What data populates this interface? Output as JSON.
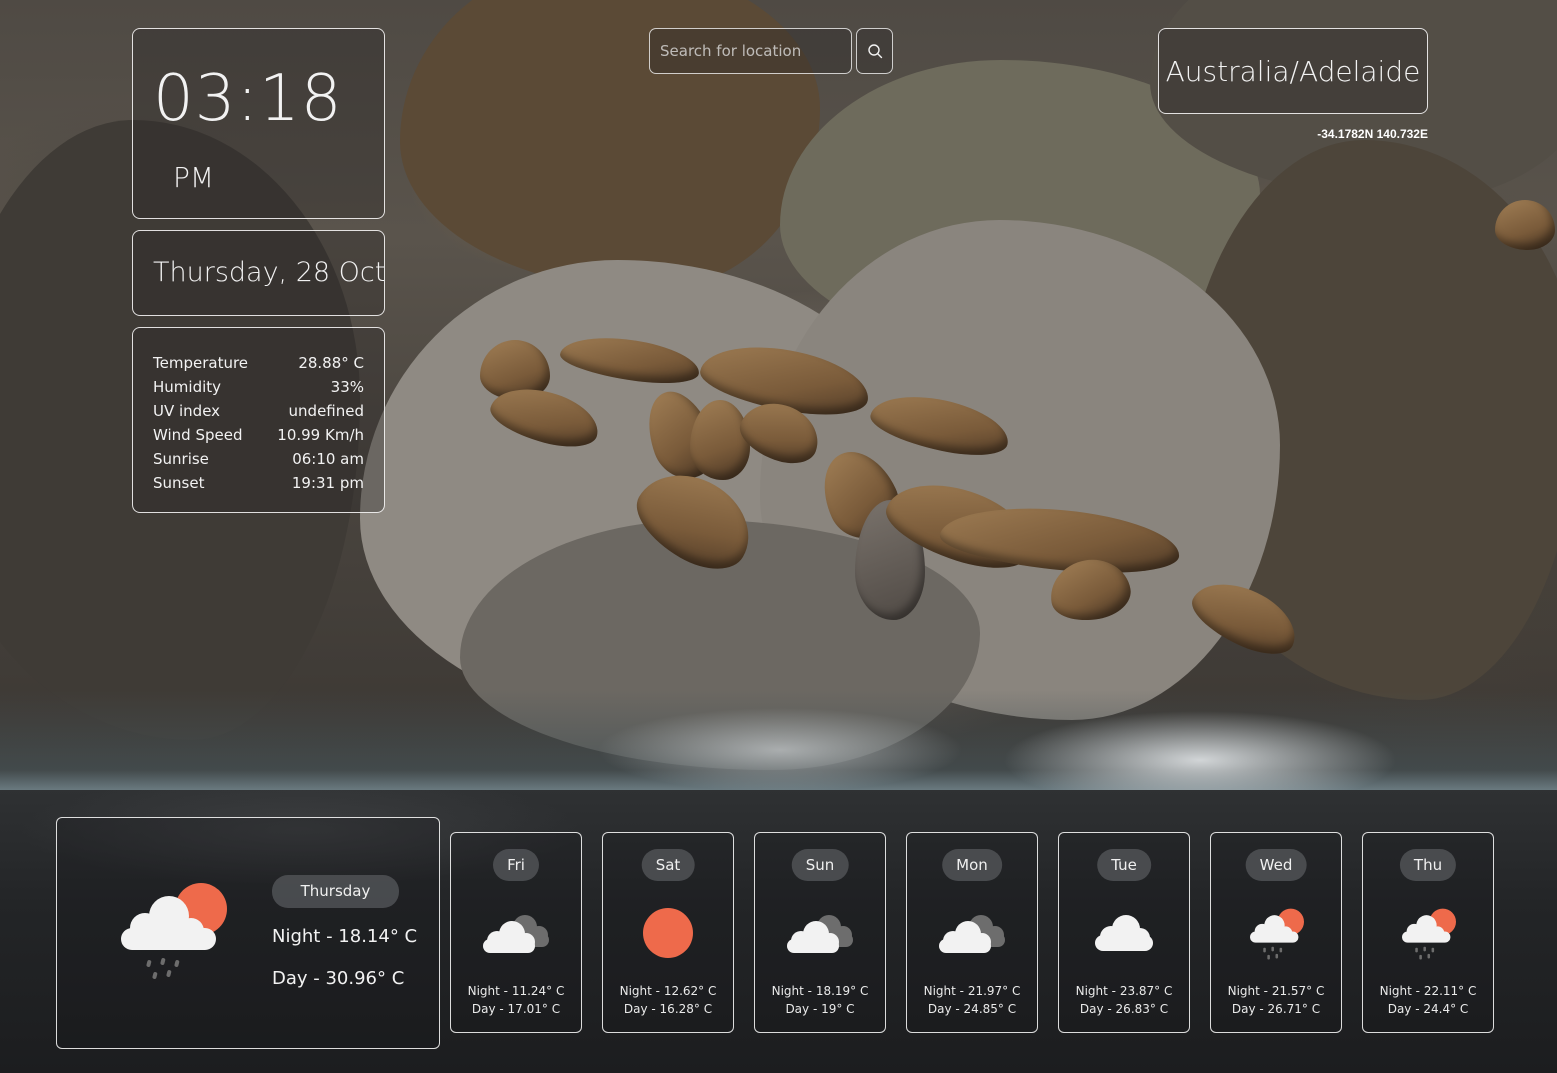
{
  "clock": {
    "time": "03:18",
    "ampm": "PM"
  },
  "date": {
    "label": "Thursday, 28 Oct"
  },
  "stats": [
    {
      "label": "Temperature",
      "value": "28.88° C"
    },
    {
      "label": "Humidity",
      "value": "33%"
    },
    {
      "label": "UV index",
      "value": "undefined"
    },
    {
      "label": "Wind Speed",
      "value": "10.99 Km/h"
    },
    {
      "label": "Sunrise",
      "value": "06:10 am"
    },
    {
      "label": "Sunset",
      "value": "19:31 pm"
    }
  ],
  "search": {
    "placeholder": "Search for location",
    "value": "",
    "icon": "search-icon"
  },
  "location": {
    "name": "Australia/Adelaide",
    "coords": "-34.1782N 140.732E"
  },
  "today": {
    "day": "Thursday",
    "night": "Night - 18.14° C",
    "daytime": "Day - 30.96° C",
    "icon": "rain-cloud-sun-icon"
  },
  "forecast": [
    {
      "day": "Fri",
      "icon": "cloudy-icon",
      "night": "Night - 11.24° C",
      "daytime": "Day - 17.01° C"
    },
    {
      "day": "Sat",
      "icon": "sun-icon",
      "night": "Night - 12.62° C",
      "daytime": "Day - 16.28° C"
    },
    {
      "day": "Sun",
      "icon": "cloudy-icon",
      "night": "Night - 18.19° C",
      "daytime": "Day - 19° C"
    },
    {
      "day": "Mon",
      "icon": "cloudy-icon",
      "night": "Night - 21.97° C",
      "daytime": "Day - 24.85° C"
    },
    {
      "day": "Tue",
      "icon": "cloud-icon",
      "night": "Night - 23.87° C",
      "daytime": "Day - 26.83° C"
    },
    {
      "day": "Wed",
      "icon": "rain-cloud-sun-icon",
      "night": "Night - 21.57° C",
      "daytime": "Day - 26.71° C"
    },
    {
      "day": "Thu",
      "icon": "rain-cloud-sun-icon",
      "night": "Night - 22.11° C",
      "daytime": "Day - 24.4° C"
    }
  ],
  "colors": {
    "sun": "#ee6a4b",
    "cloud": "#f2f2f2",
    "cloud_dark": "#6d6d6d",
    "pill": "#505256"
  }
}
